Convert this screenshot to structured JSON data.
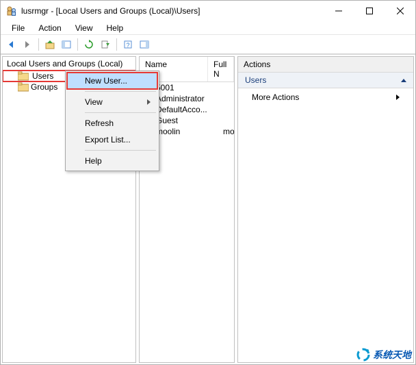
{
  "window": {
    "title": "lusrmgr - [Local Users and Groups (Local)\\Users]"
  },
  "menubar": {
    "items": [
      "File",
      "Action",
      "View",
      "Help"
    ]
  },
  "tree": {
    "root": "Local Users and Groups (Local)",
    "items": [
      {
        "label": "Users"
      },
      {
        "label": "Groups"
      }
    ]
  },
  "list": {
    "columns": {
      "name": "Name",
      "full": "Full N"
    },
    "rows": [
      {
        "name": "5001",
        "full": ""
      },
      {
        "name": "Administrator",
        "full": ""
      },
      {
        "name": "DefaultAcco...",
        "full": ""
      },
      {
        "name": "Guest",
        "full": ""
      },
      {
        "name": "moolin",
        "full": "mool"
      }
    ]
  },
  "context_menu": {
    "new_user": "New User...",
    "view": "View",
    "refresh": "Refresh",
    "export": "Export List...",
    "help": "Help"
  },
  "actions": {
    "header": "Actions",
    "section": "Users",
    "more": "More Actions"
  },
  "watermark": "系统天地"
}
